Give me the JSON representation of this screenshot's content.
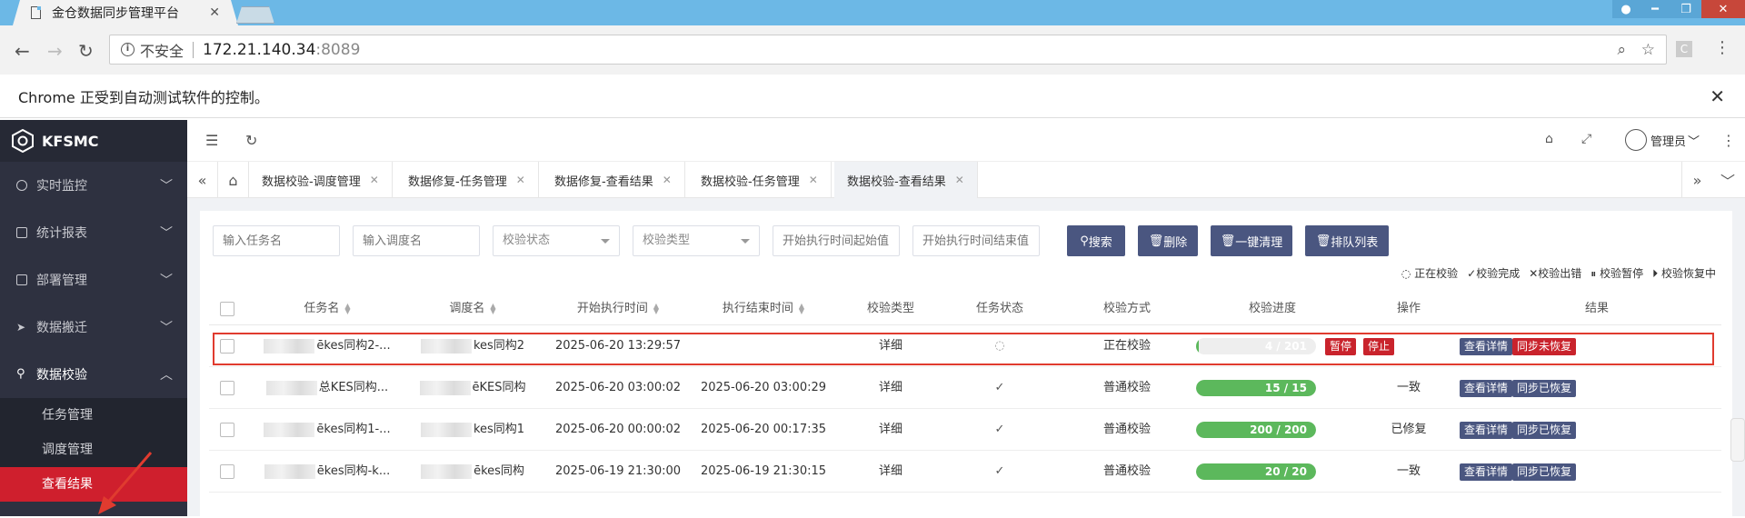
{
  "browser": {
    "tab_title": "金仓数据同步管理平台",
    "insecure_label": "不安全",
    "url_host": "172.21.140.34",
    "url_port": ":8089",
    "ext_label": "C",
    "infobar_text": "Chrome 正受到自动测试软件的控制。"
  },
  "app": {
    "logo_text": "KFSMC",
    "admin_label": "管理员"
  },
  "sidebar": {
    "items": [
      {
        "label": "实时监控"
      },
      {
        "label": "统计报表"
      },
      {
        "label": "部署管理"
      },
      {
        "label": "数据搬迁"
      },
      {
        "label": "数据校验"
      }
    ],
    "sub_items": [
      {
        "label": "任务管理"
      },
      {
        "label": "调度管理"
      },
      {
        "label": "查看结果"
      }
    ]
  },
  "page_tabs": [
    {
      "label": "数据校验-调度管理"
    },
    {
      "label": "数据修复-任务管理"
    },
    {
      "label": "数据修复-查看结果"
    },
    {
      "label": "数据校验-任务管理"
    },
    {
      "label": "数据校验-查看结果"
    }
  ],
  "filters": {
    "task_name": "输入任务名",
    "schedule_name": "输入调度名",
    "check_status": "校验状态",
    "check_type": "校验类型",
    "start_from": "开始执行时间起始值",
    "start_to": "开始执行时间结束值"
  },
  "buttons": {
    "search": "搜索",
    "delete": "删除",
    "clear_all": "一键清理",
    "queue": "排队列表"
  },
  "legend": [
    {
      "icon": "spinner-icon",
      "label": "正在校验"
    },
    {
      "icon": "check-icon",
      "label": "校验完成"
    },
    {
      "icon": "x-icon",
      "label": "校验出错"
    },
    {
      "icon": "pause-icon",
      "label": "校验暂停"
    },
    {
      "icon": "play-icon",
      "label": "校验恢复中"
    }
  ],
  "table": {
    "headers": [
      "任务名",
      "调度名",
      "开始执行时间",
      "执行结束时间",
      "校验类型",
      "任务状态",
      "校验方式",
      "校验进度",
      "操作",
      "结果"
    ],
    "rows": [
      {
        "task": "ēkes同构2-...",
        "schedule": "kes同构2",
        "start": "2025-06-20 13:29:57",
        "end": "",
        "type": "详细",
        "status": "running",
        "mode": "正在校验",
        "progress_text": "4 / 201",
        "progress": 0.02,
        "op": "",
        "op_btns": [
          "暂停",
          "停止"
        ],
        "result_btns": [
          "查看详情",
          "同步未恢复"
        ]
      },
      {
        "task": "总KES同构...",
        "schedule": "ēKES同构",
        "start": "2025-06-20 03:00:02",
        "end": "2025-06-20 03:00:29",
        "type": "详细",
        "status": "done",
        "mode": "普通校验",
        "progress_text": "15 / 15",
        "progress": 1.0,
        "op": "一致",
        "op_btns": [],
        "result_btns": [
          "查看详情",
          "同步已恢复"
        ]
      },
      {
        "task": "ēkes同构1-...",
        "schedule": "kes同构1",
        "start": "2025-06-20 00:00:02",
        "end": "2025-06-20 00:17:35",
        "type": "详细",
        "status": "done",
        "mode": "普通校验",
        "progress_text": "200 / 200",
        "progress": 1.0,
        "op": "已修复",
        "op_btns": [],
        "result_btns": [
          "查看详情",
          "同步已恢复"
        ]
      },
      {
        "task": "ēkes同构-k...",
        "schedule": "ēkes同构",
        "start": "2025-06-19 21:30:00",
        "end": "2025-06-19 21:30:15",
        "type": "详细",
        "status": "done",
        "mode": "普通校验",
        "progress_text": "20 / 20",
        "progress": 1.0,
        "op": "一致",
        "op_btns": [],
        "result_btns": [
          "查看详情",
          "同步已恢复"
        ]
      }
    ]
  }
}
